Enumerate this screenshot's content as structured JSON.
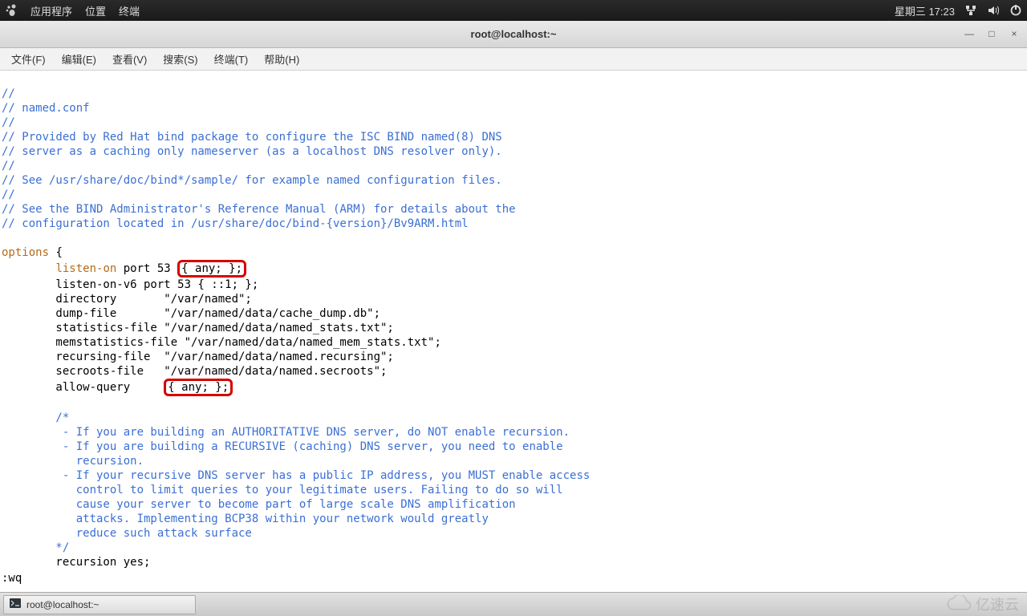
{
  "topbar": {
    "apps": "应用程序",
    "places": "位置",
    "terminal": "终端",
    "datetime": "星期三 17:23"
  },
  "window": {
    "title": "root@localhost:~"
  },
  "winbtns": {
    "min": "—",
    "max": "□",
    "close": "×"
  },
  "menubar": {
    "file": "文件(F)",
    "edit": "编辑(E)",
    "view": "查看(V)",
    "search": "搜索(S)",
    "terminal": "终端(T)",
    "help": "帮助(H)"
  },
  "conf": {
    "c01": "//",
    "c02": "// named.conf",
    "c03": "//",
    "c04": "// Provided by Red Hat bind package to configure the ISC BIND named(8) DNS",
    "c05": "// server as a caching only nameserver (as a localhost DNS resolver only).",
    "c06": "//",
    "c07": "// See /usr/share/doc/bind*/sample/ for example named configuration files.",
    "c08": "//",
    "c09": "// See the BIND Administrator's Reference Manual (ARM) for details about the",
    "c10": "// configuration located in /usr/share/doc/bind-{version}/Bv9ARM.html",
    "k_options": "options",
    "brace_open": " {",
    "k_listen": "listen-on",
    "listen_rest": " port 53 ",
    "box1": "{ any; };",
    "l_v6": "        listen-on-v6 port 53 { ::1; };",
    "l_dir": "        directory       \"/var/named\";",
    "l_dump": "        dump-file       \"/var/named/data/cache_dump.db\";",
    "l_stat": "        statistics-file \"/var/named/data/named_stats.txt\";",
    "l_mem": "        memstatistics-file \"/var/named/data/named_mem_stats.txt\";",
    "l_rec": "        recursing-file  \"/var/named/data/named.recursing\";",
    "l_secr": "        secroots-file   \"/var/named/data/named.secroots\";",
    "l_aq_lbl": "        allow-query     ",
    "box2": "{ any; };",
    "b01": "        /*",
    "b02": "         - If you are building an AUTHORITATIVE DNS server, do NOT enable recursion.",
    "b03": "         - If you are building a RECURSIVE (caching) DNS server, you need to enable",
    "b04": "           recursion.",
    "b05": "         - If your recursive DNS server has a public IP address, you MUST enable access",
    "b06": "           control to limit queries to your legitimate users. Failing to do so will",
    "b07": "           cause your server to become part of large scale DNS amplification",
    "b08": "           attacks. Implementing BCP38 within your network would greatly",
    "b09": "           reduce such attack surface",
    "b10": "        */",
    "l_recursion": "        recursion yes;",
    "vim": ":wq"
  },
  "taskbar": {
    "item1": "root@localhost:~"
  },
  "watermark": "亿速云"
}
